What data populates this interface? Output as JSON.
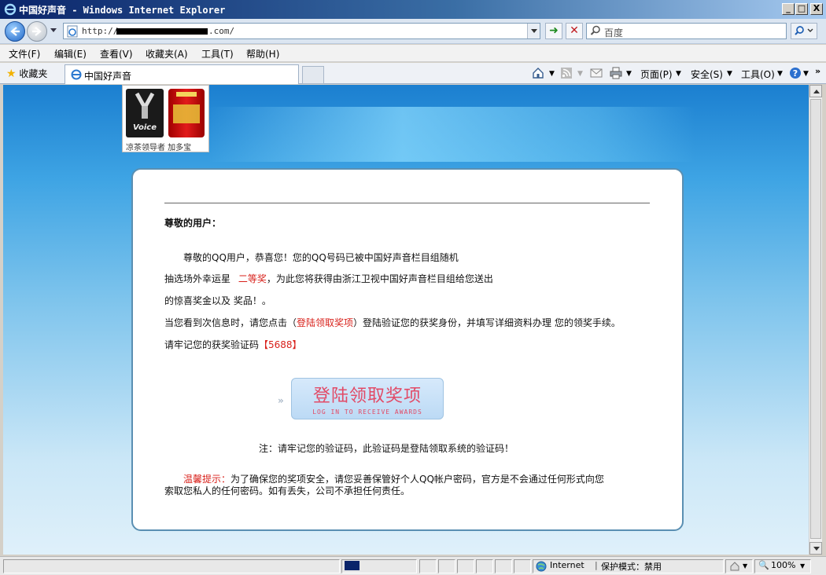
{
  "window": {
    "title": "中国好声音 - Windows Internet Explorer",
    "minimize": "_",
    "maximize": "□",
    "close": "X"
  },
  "address": {
    "url_prefix": "http://",
    "url_suffix": ".com/",
    "search_placeholder": "百度"
  },
  "menu": [
    "文件(F)",
    "编辑(E)",
    "查看(V)",
    "收藏夹(A)",
    "工具(T)",
    "帮助(H)"
  ],
  "favorites": {
    "label": "收藏夹",
    "tab_title": "中国好声音"
  },
  "commandbar": {
    "page": "页面(P)",
    "safety": "安全(S)",
    "tools": "工具(O)"
  },
  "banner": {
    "caption": "凉茶领导者  加多宝"
  },
  "letter": {
    "greeting": "尊敬的用户：",
    "line1": "尊敬的QQ用户，恭喜您！您的QQ号码已被中国好声音栏目组随机",
    "line2_pre": "抽选场外幸运星",
    "prize": "二等奖",
    "line2_post": "，为此您将获得由浙江卫视中国好声音栏目组给您送出",
    "line3": "的惊喜奖金以及 奖品！。",
    "line4_pre": "当您看到次信息时，请您点击（",
    "line4_link": "登陆领取奖项",
    "line4_post": "）登陆验证您的获奖身份，并填写详细资料办理 您的领奖手续。",
    "line5_pre": "请牢记您的获奖验证码",
    "code": "【5688】",
    "claim_main": "登陆领取奖项",
    "claim_sub": "LOG IN TO RECEIVE AWARDS",
    "note": "注：请牢记您的验证码，此验证码是登陆领取系统的验证码！",
    "tip_label": "温馨提示：",
    "tip_text1": "为了确保您的奖项安全，请您妥善保管好个人QQ帐户密码，官方是不会通过任何形式向您",
    "tip_text2": "索取您私人的任何密码。如有丢失，公司不承担任何责任。"
  },
  "status": {
    "zone": "Internet",
    "protected_mode": "保护模式：禁用",
    "zoom": "100%"
  }
}
